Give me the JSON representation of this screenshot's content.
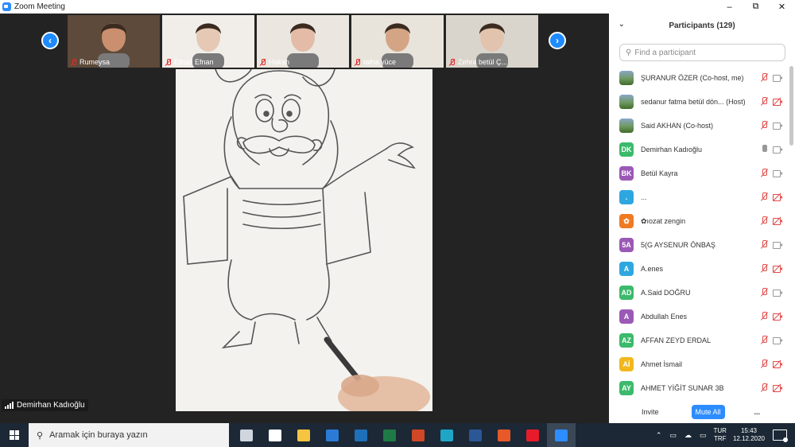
{
  "window": {
    "title": "Zoom Meeting",
    "minimize": "–",
    "maximize": "⧉",
    "close": "✕"
  },
  "thumbnails": [
    {
      "name": "Rumeysa",
      "skin": "#c98f6e",
      "bg": "#5d4a3a"
    },
    {
      "name": "Efnan Efnan",
      "skin": "#e5c9b5",
      "bg": "#f1eeea"
    },
    {
      "name": "Hakan",
      "skin": "#e3bba6",
      "bg": "#ebe7e0"
    },
    {
      "name": "talha yüce",
      "skin": "#d4a585",
      "bg": "#e8e4dc"
    },
    {
      "name": "Zehra betül Ç...",
      "skin": "#e2c4ae",
      "bg": "#d9d5cc"
    }
  ],
  "nav": {
    "prev": "‹",
    "next": "›"
  },
  "speaker": {
    "name": "Demirhan Kadıoğlu"
  },
  "panel": {
    "title": "Participants (129)",
    "search_placeholder": "Find a participant",
    "invite": "Invite",
    "mute_all": "Mute All",
    "more": "...",
    "participants": [
      {
        "name": "ŞURANUR ÖZER (Co-host, me)",
        "initials": "",
        "color": "photo",
        "mic": "off",
        "cam": "on"
      },
      {
        "name": "sedanur fatma betül dön... (Host)",
        "initials": "",
        "color": "photo",
        "mic": "off",
        "cam": "off"
      },
      {
        "name": "Said AKHAN (Co-host)",
        "initials": "",
        "color": "photo",
        "mic": "off",
        "cam": "on"
      },
      {
        "name": "Demirhan Kadıoğlu",
        "initials": "DK",
        "color": "#3cba6b",
        "mic": "on",
        "cam": "on"
      },
      {
        "name": " Betül Kayra",
        "initials": "BK",
        "color": "#9b59b6",
        "mic": "off",
        "cam": "on"
      },
      {
        "name": "...",
        "initials": ".",
        "color": "#2ea7e0",
        "mic": "off",
        "cam": "off"
      },
      {
        "name": "✿ıozat zengin",
        "initials": "✿",
        "color": "#ef7a22",
        "mic": "off",
        "cam": "off"
      },
      {
        "name": "5(G AYSENUR ÖNBAŞ",
        "initials": "5A",
        "color": "#9b59b6",
        "mic": "off",
        "cam": "on"
      },
      {
        "name": "A.enes",
        "initials": "A",
        "color": "#2ea7e0",
        "mic": "off",
        "cam": "off"
      },
      {
        "name": "A.Said DOĞRU",
        "initials": "AD",
        "color": "#3cba6b",
        "mic": "off",
        "cam": "on"
      },
      {
        "name": "Abdullah Enes",
        "initials": "A",
        "color": "#9b59b6",
        "mic": "off",
        "cam": "off"
      },
      {
        "name": "AFFAN ZEYD ERDAL",
        "initials": "AZ",
        "color": "#3cba6b",
        "mic": "off",
        "cam": "on"
      },
      {
        "name": "Ahmet İsmail",
        "initials": "Aİ",
        "color": "#f1b81d",
        "mic": "off",
        "cam": "off"
      },
      {
        "name": "AHMET YİĞİT SUNAR 3B",
        "initials": "AY",
        "color": "#3cba6b",
        "mic": "off",
        "cam": "off"
      }
    ]
  },
  "taskbar": {
    "search_placeholder": "Aramak için buraya yazın",
    "apps": [
      {
        "name": "task-view",
        "color": "#cfd6de",
        "active": false
      },
      {
        "name": "store",
        "color": "#ffffff",
        "active": false
      },
      {
        "name": "file-explorer",
        "color": "#f5c542",
        "active": false
      },
      {
        "name": "remote-desktop",
        "color": "#2b7bd6",
        "active": false
      },
      {
        "name": "app-blue",
        "color": "#1f6fb8",
        "active": false
      },
      {
        "name": "excel",
        "color": "#1f7b45",
        "active": false
      },
      {
        "name": "powerpoint",
        "color": "#d24726",
        "active": false
      },
      {
        "name": "edge",
        "color": "#1fa6c7",
        "active": false
      },
      {
        "name": "word",
        "color": "#2b5797",
        "active": false
      },
      {
        "name": "office",
        "color": "#e8592a",
        "active": false
      },
      {
        "name": "opera",
        "color": "#e81b2a",
        "active": false
      },
      {
        "name": "zoom",
        "color": "#2d8cff",
        "active": true
      }
    ],
    "tray_chevron": "⌃",
    "lang_top": "TUR",
    "lang_bottom": "TRF",
    "time": "15:43",
    "date": "12.12.2020"
  }
}
